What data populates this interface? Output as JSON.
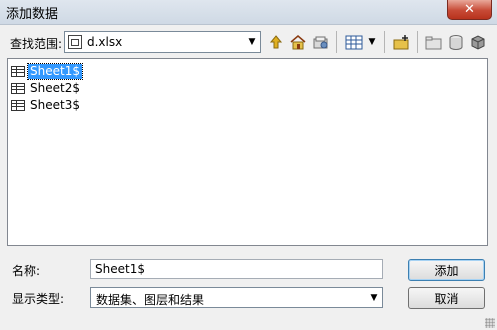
{
  "window": {
    "title": "添加数据",
    "close_glyph": "✕"
  },
  "toolbar": {
    "look_in_label": "查找范围:",
    "location_value": "d.xlsx",
    "buttons": [
      {
        "icon": "up-one-level-icon"
      },
      {
        "icon": "home-icon"
      },
      {
        "icon": "connect-folder-icon"
      },
      {
        "icon": "list-view-icon"
      },
      {
        "icon": "view-options-dropdown-icon"
      },
      {
        "icon": "new-connection-icon"
      },
      {
        "icon": "folder-icon"
      },
      {
        "icon": "database-icon"
      },
      {
        "icon": "catalog-options-icon"
      }
    ]
  },
  "list": {
    "items": [
      {
        "label": "Sheet1$",
        "selected": true
      },
      {
        "label": "Sheet2$",
        "selected": false
      },
      {
        "label": "Sheet3$",
        "selected": false
      }
    ]
  },
  "form": {
    "name_label": "名称:",
    "name_value": "Sheet1$",
    "type_label": "显示类型:",
    "type_value": "数据集、图层和结果"
  },
  "buttons": {
    "add_label": "添加",
    "cancel_label": "取消"
  },
  "colors": {
    "selection": "#3399ff",
    "close_button": "#c74a36"
  }
}
